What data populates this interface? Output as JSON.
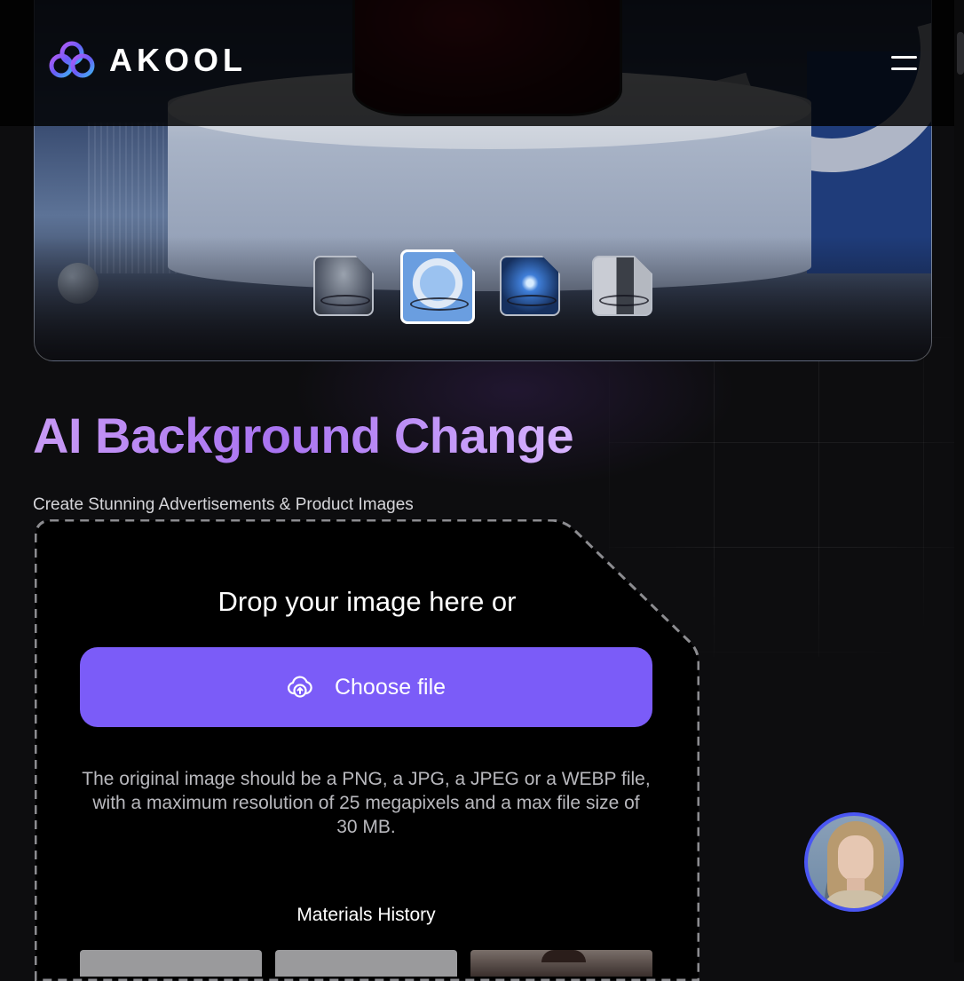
{
  "header": {
    "logo_text": "AKOOL",
    "menu_icon": "hamburger-icon"
  },
  "hero": {
    "thumbnails": [
      {
        "name": "background-option-1",
        "active": false
      },
      {
        "name": "background-option-2",
        "active": true
      },
      {
        "name": "background-option-3",
        "active": false
      },
      {
        "name": "background-option-4",
        "active": false
      }
    ]
  },
  "main": {
    "title": "AI Background Change",
    "subtitle": "Create Stunning Advertisements & Product Images"
  },
  "upload": {
    "drop_text": "Drop your image here or",
    "button_label": "Choose file",
    "button_icon": "upload-cloud-icon",
    "hint": "The original image should be a PNG, a JPG, a JPEG or a WEBP file, with a maximum resolution of 25 megapixels and a max file size of 30 MB.",
    "history_title": "Materials History"
  },
  "colors": {
    "accent": "#7b5cf8",
    "title_gradient_start": "#c89af5",
    "title_gradient_end": "#a873f0",
    "avatar_ring": "#4a56f2"
  }
}
